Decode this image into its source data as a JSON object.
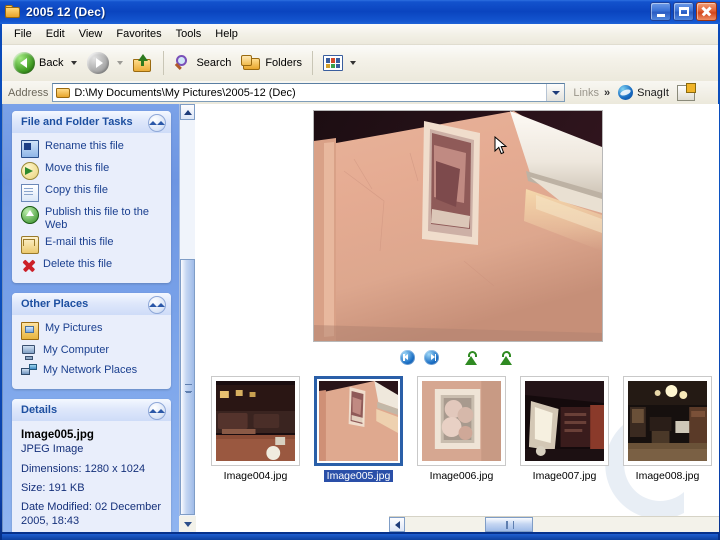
{
  "window": {
    "title": "2005 12 (Dec)",
    "icon": "folder-icon",
    "minimize_label": "Minimize",
    "maximize_label": "Maximize",
    "close_label": "Close"
  },
  "menubar": {
    "items": [
      {
        "label": "File"
      },
      {
        "label": "Edit"
      },
      {
        "label": "View"
      },
      {
        "label": "Favorites"
      },
      {
        "label": "Tools"
      },
      {
        "label": "Help"
      }
    ]
  },
  "toolbar": {
    "back_label": "Back",
    "forward_label": "",
    "up_label": "",
    "search_label": "Search",
    "folders_label": "Folders",
    "views_label": ""
  },
  "address": {
    "label": "Address",
    "path": "D:\\My Documents\\My Pictures\\2005-12 (Dec)",
    "links_label": "Links",
    "chevron_label": "»",
    "snagit_label": "SnagIt"
  },
  "sidebar": {
    "panels": [
      {
        "title": "File and Folder Tasks",
        "items": [
          {
            "label": "Rename this file",
            "icon": "rename-icon"
          },
          {
            "label": "Move this file",
            "icon": "move-icon"
          },
          {
            "label": "Copy this file",
            "icon": "copy-icon"
          },
          {
            "label": "Publish this file to the Web",
            "icon": "publish-icon"
          },
          {
            "label": "E-mail this file",
            "icon": "email-icon"
          },
          {
            "label": "Delete this file",
            "icon": "delete-icon"
          }
        ]
      },
      {
        "title": "Other Places",
        "items": [
          {
            "label": "My Pictures",
            "icon": "my-pictures-icon"
          },
          {
            "label": "My Computer",
            "icon": "my-computer-icon"
          },
          {
            "label": "My Network Places",
            "icon": "my-network-places-icon"
          }
        ]
      },
      {
        "title": "Details",
        "file_name": "Image005.jpg",
        "file_type": "JPEG Image",
        "dimensions": "Dimensions: 1280 x 1024",
        "size": "Size: 191 KB",
        "date_modified": "Date Modified: 02 December 2005, 18:43"
      }
    ]
  },
  "filmstrip": {
    "nav": {
      "previous_label": "Previous Image",
      "next_label": "Next Image",
      "rotate_cw_label": "Rotate Clockwise",
      "rotate_ccw_label": "Rotate Counterclockwise"
    },
    "thumbnails": [
      {
        "name": "Image004.jpg",
        "selected": false
      },
      {
        "name": "Image005.jpg",
        "selected": true
      },
      {
        "name": "Image006.jpg",
        "selected": false
      },
      {
        "name": "Image007.jpg",
        "selected": false
      },
      {
        "name": "Image008.jpg",
        "selected": false
      }
    ]
  },
  "colors": {
    "titlebar": "#0a44bf",
    "sidebar": "#7ba2e8",
    "panel_title": "#1d4fa0",
    "selection": "#2a4fa8",
    "close_button": "#d2451c"
  }
}
